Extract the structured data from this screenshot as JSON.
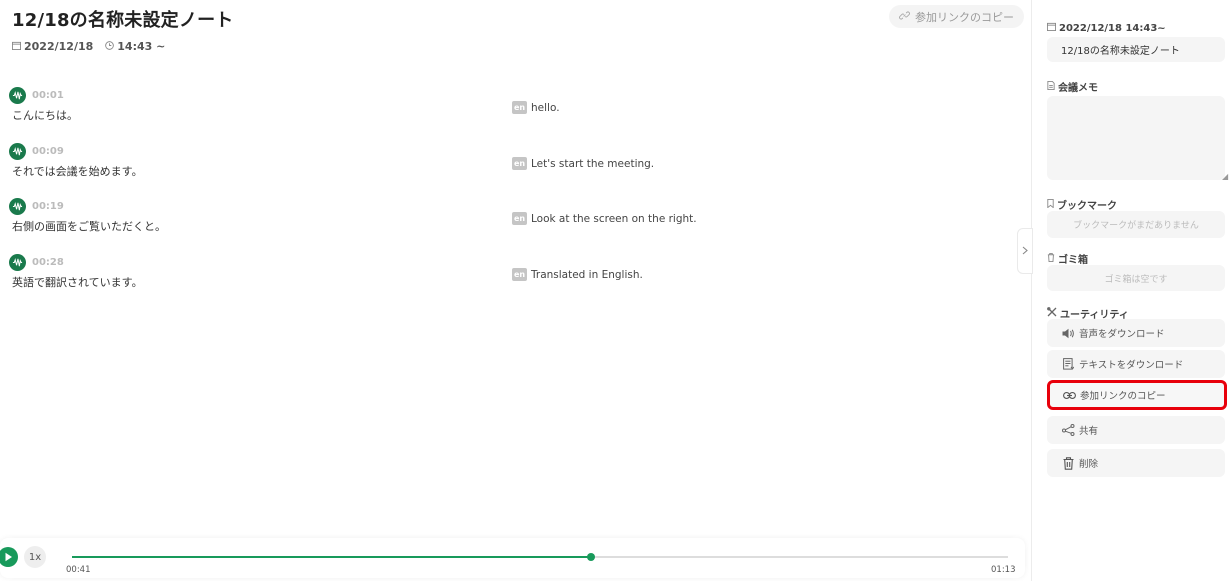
{
  "note": {
    "title": "12/18の名称未設定ノート",
    "date": "2022/12/18",
    "time": "14:43 ~",
    "copy_link_label": "参加リンクのコピー"
  },
  "transcript": [
    {
      "timestamp": "00:01",
      "text": "こんにちは。",
      "lang": "en",
      "translation": "hello."
    },
    {
      "timestamp": "00:09",
      "text": "それでは会議を始めます。",
      "lang": "en",
      "translation": "Let's start the meeting."
    },
    {
      "timestamp": "00:19",
      "text": "右側の画面をご覧いただくと。",
      "lang": "en",
      "translation": "Look at the screen on the right."
    },
    {
      "timestamp": "00:28",
      "text": "英語で翻訳されています。",
      "lang": "en",
      "translation": "Translated in English."
    }
  ],
  "player": {
    "speed": "1x",
    "current_time": "00:41",
    "total_time": "01:13",
    "progress": 0.555,
    "accent": "#189a5b"
  },
  "sidebar": {
    "datetime_label": "2022/12/18 14:43~",
    "title_value": "12/18の名称未設定ノート",
    "memo_label": "会議メモ",
    "memo_value": "",
    "bookmark_label": "ブックマーク",
    "bookmark_empty": "ブックマークがまだありません",
    "trash_label": "ゴミ箱",
    "trash_empty": "ゴミ箱は空です",
    "utility_label": "ユーティリティ",
    "utilities": [
      {
        "label": "音声をダウンロード",
        "icon": "speaker-icon"
      },
      {
        "label": "テキストをダウンロード",
        "icon": "text-file-icon"
      },
      {
        "label": "参加リンクのコピー",
        "icon": "link-icon",
        "highlighted": true
      },
      {
        "label": "共有",
        "icon": "share-icon"
      },
      {
        "label": "削除",
        "icon": "trash-icon"
      }
    ]
  },
  "colors": {
    "highlight_border": "#e8000b",
    "avatar": "#1a7a4c"
  }
}
